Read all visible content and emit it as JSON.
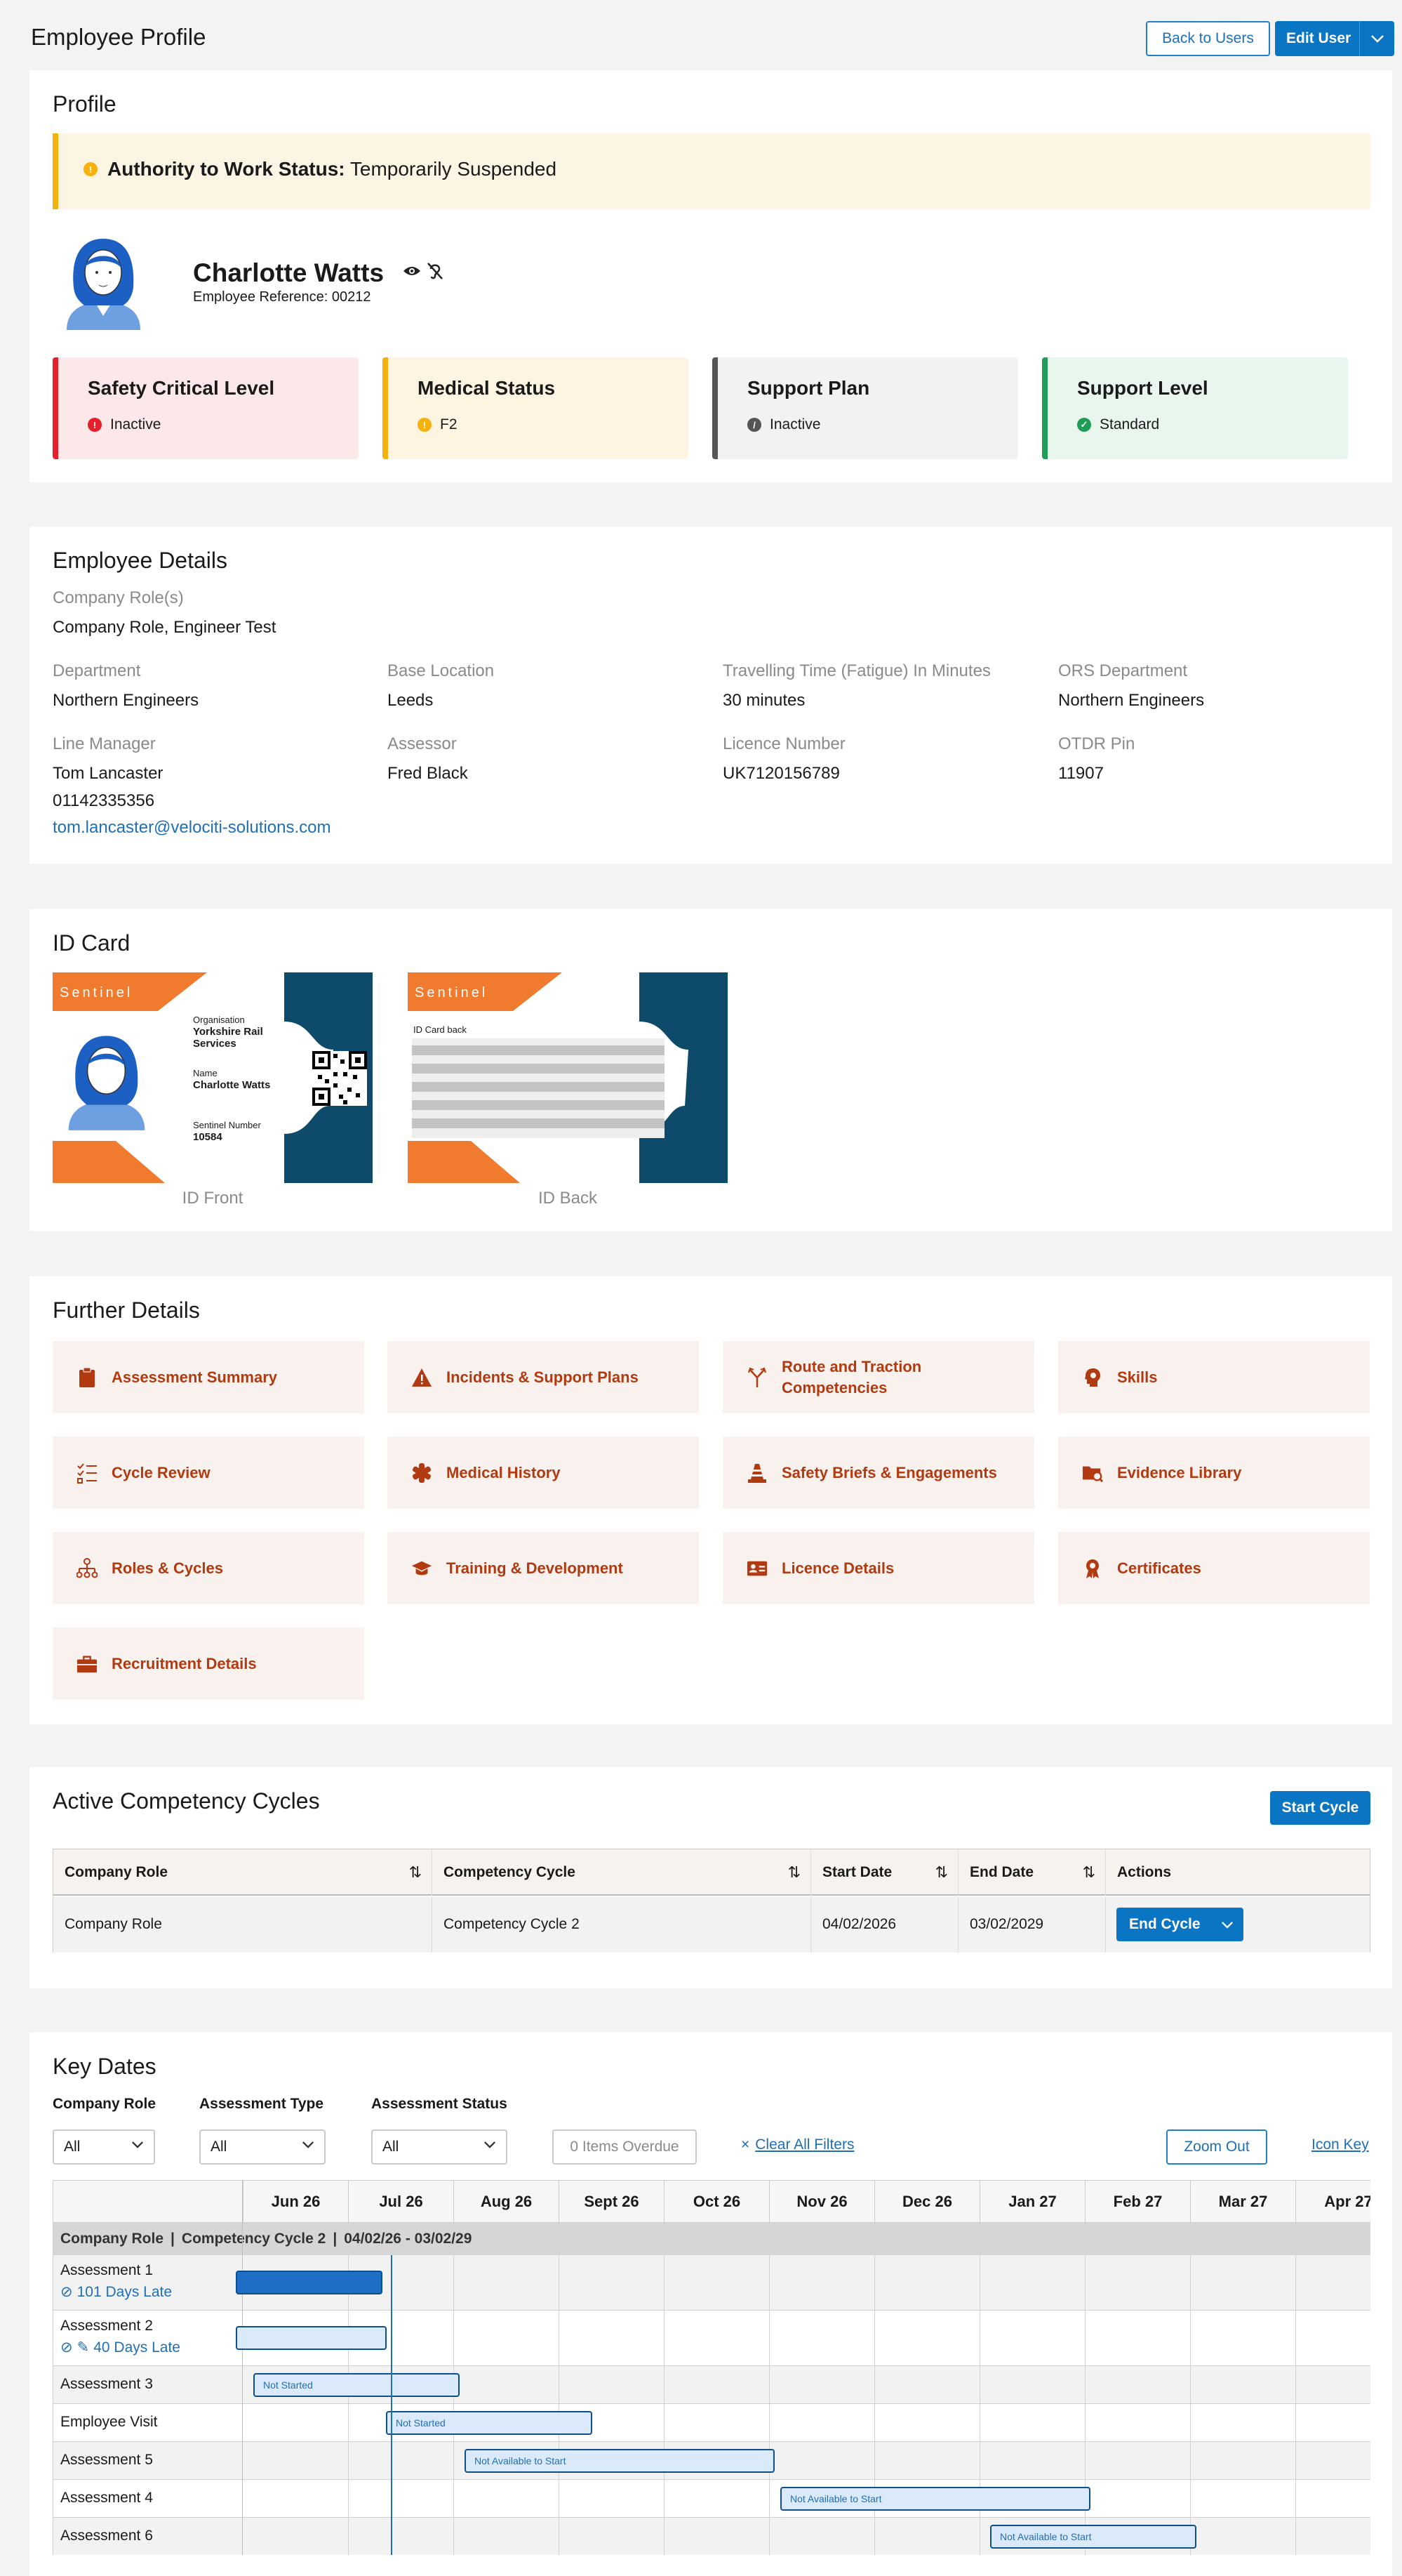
{
  "header": {
    "title": "Employee Profile",
    "back_label": "Back to Users",
    "edit_label": "Edit User"
  },
  "profile": {
    "section_title": "Profile",
    "alert_label": "Authority to Work Status:",
    "alert_value": "Temporarily Suspended",
    "name": "Charlotte Watts",
    "reference": "Employee Reference: 00212",
    "status_cards": [
      {
        "title": "Safety Critical Level",
        "value": "Inactive",
        "color": "#e5202b",
        "bg": "#fce8e8"
      },
      {
        "title": "Medical Status",
        "value": "F2",
        "color": "#f5b20e",
        "bg": "#fdf4e2"
      },
      {
        "title": "Support Plan",
        "value": "Inactive",
        "color": "#555555",
        "bg": "#f2f2f2"
      },
      {
        "title": "Support Level",
        "value": "Standard",
        "color": "#1f9d57",
        "bg": "#e9f6ee"
      }
    ]
  },
  "details": {
    "section_title": "Employee Details",
    "company_roles_label": "Company Role(s)",
    "company_roles_value": "Company Role, Engineer Test",
    "fields": [
      {
        "label": "Department",
        "value": "Northern Engineers"
      },
      {
        "label": "Base Location",
        "value": "Leeds"
      },
      {
        "label": "Travelling Time (Fatigue) In Minutes",
        "value": "30 minutes"
      },
      {
        "label": "ORS Department",
        "value": "Northern Engineers"
      },
      {
        "label": "Line Manager",
        "value": "Tom Lancaster"
      },
      {
        "label": "Assessor",
        "value": "Fred Black"
      },
      {
        "label": "Licence Number",
        "value": "UK7120156789"
      },
      {
        "label": "OTDR Pin",
        "value": "11907"
      }
    ],
    "manager_phone": "01142335356",
    "manager_email": "tom.lancaster@velociti-solutions.com"
  },
  "id_card": {
    "section_title": "ID Card",
    "brand": "Sentinel",
    "org_label": "Organisation",
    "org_value": "Yorkshire Rail Services",
    "name_label": "Name",
    "name_value": "Charlotte Watts",
    "number_label": "Sentinel Number",
    "number_value": "10584",
    "back_label": "ID Card back",
    "front_caption": "ID Front",
    "back_caption": "ID Back"
  },
  "further": {
    "section_title": "Further Details",
    "tiles": [
      {
        "label": "Assessment Summary",
        "icon": "clipboard-icon"
      },
      {
        "label": "Incidents & Support Plans",
        "icon": "warning-icon"
      },
      {
        "label": "Route and Traction Competencies",
        "icon": "route-icon"
      },
      {
        "label": "Skills",
        "icon": "skills-icon"
      },
      {
        "label": "Cycle Review",
        "icon": "checklist-icon"
      },
      {
        "label": "Medical History",
        "icon": "medical-icon"
      },
      {
        "label": "Safety Briefs & Engagements",
        "icon": "cone-icon"
      },
      {
        "label": "Evidence Library",
        "icon": "folder-search-icon"
      },
      {
        "label": "Roles & Cycles",
        "icon": "hierarchy-icon"
      },
      {
        "label": "Training & Development",
        "icon": "graduation-cap-icon"
      },
      {
        "label": "Licence Details",
        "icon": "id-badge-icon"
      },
      {
        "label": "Certificates",
        "icon": "certificate-icon"
      },
      {
        "label": "Recruitment Details",
        "icon": "briefcase-icon"
      }
    ]
  },
  "cycles": {
    "section_title": "Active Competency Cycles",
    "start_label": "Start Cycle",
    "columns": [
      "Company Role",
      "Competency Cycle",
      "Start Date",
      "End Date",
      "Actions"
    ],
    "rows": [
      {
        "role": "Company Role",
        "cycle": "Competency Cycle 2",
        "start": "04/02/2026",
        "end": "03/02/2029",
        "action": "End Cycle"
      }
    ]
  },
  "key_dates": {
    "section_title": "Key Dates",
    "filters": {
      "role_label": "Company Role",
      "role_value": "All",
      "type_label": "Assessment Type",
      "type_value": "All",
      "status_label": "Assessment Status",
      "status_value": "All",
      "overdue": "0 Items Overdue",
      "clear": "Clear All Filters",
      "zoom": "Zoom Out",
      "icon_key": "Icon Key"
    },
    "months": [
      "Jun 26",
      "Jul 26",
      "Aug 26",
      "Sept 26",
      "Oct 26",
      "Nov 26",
      "Dec 26",
      "Jan 27",
      "Feb 27",
      "Mar 27",
      "Apr 27"
    ],
    "group_header": {
      "role": "Company Role",
      "cycle": "Competency Cycle 2",
      "dates": "04/02/26 - 03/02/29"
    },
    "rows": [
      {
        "name": "Assessment 1",
        "late": "101 Days Late",
        "bar_label": ""
      },
      {
        "name": "Assessment 2",
        "late": "40 Days Late",
        "bar_label": ""
      },
      {
        "name": "Assessment 3",
        "late": "",
        "bar_label": "Not Started"
      },
      {
        "name": "Employee Visit",
        "late": "",
        "bar_label": "Not Started"
      },
      {
        "name": "Assessment 5",
        "late": "",
        "bar_label": "Not Available to Start"
      },
      {
        "name": "Assessment 4",
        "late": "",
        "bar_label": "Not Available to Start"
      },
      {
        "name": "Assessment 6",
        "late": "",
        "bar_label": "Not Available to Start"
      }
    ],
    "accent": "#1f6fb7"
  }
}
